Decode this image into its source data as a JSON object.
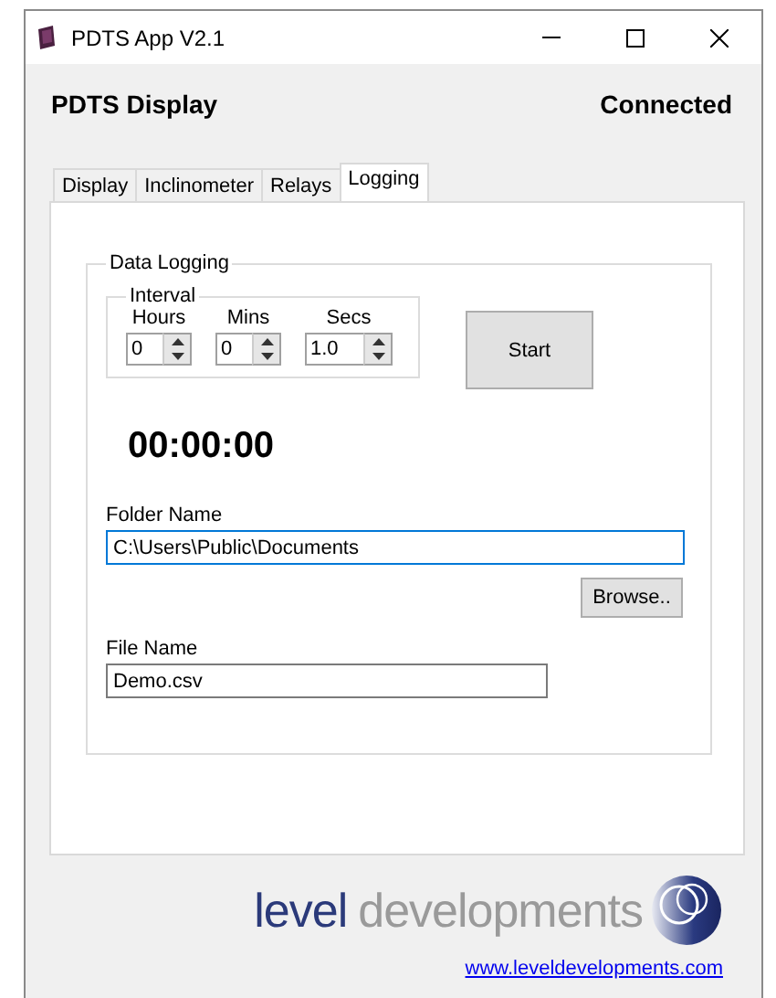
{
  "window": {
    "title": "PDTS App V2.1"
  },
  "header": {
    "title": "PDTS Display",
    "status": "Connected"
  },
  "tabs": [
    {
      "label": "Display",
      "selected": false
    },
    {
      "label": "Inclinometer",
      "selected": false
    },
    {
      "label": "Relays",
      "selected": false
    },
    {
      "label": "Logging",
      "selected": true
    }
  ],
  "data_logging": {
    "title": "Data Logging",
    "interval": {
      "title": "Interval",
      "fields": [
        {
          "label": "Hours",
          "value": "0"
        },
        {
          "label": "Mins",
          "value": "0"
        },
        {
          "label": "Secs",
          "value": "1.0"
        }
      ]
    },
    "start_button": "Start",
    "timer": "00:00:00",
    "folder": {
      "label": "Folder Name",
      "value": "C:\\Users\\Public\\Documents",
      "focused": true
    },
    "browse_button": "Browse..",
    "file": {
      "label": "File Name",
      "value": "Demo.csv",
      "focused": false
    }
  },
  "logo": {
    "first": "level",
    "second": "developments"
  },
  "link": "www.leveldevelopments.com"
}
